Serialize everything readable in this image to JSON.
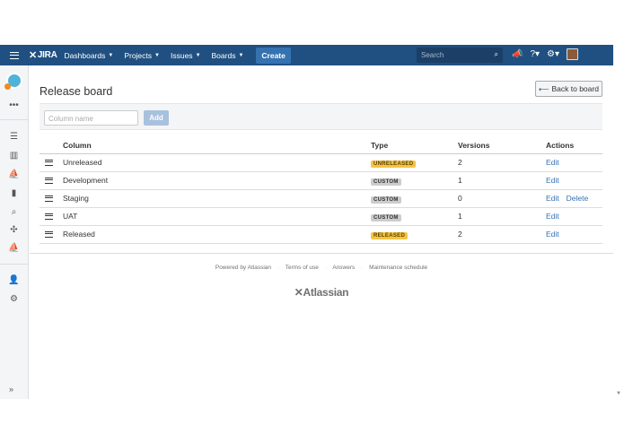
{
  "header": {
    "logo_text": "JIRA",
    "nav": [
      {
        "label": "Dashboards"
      },
      {
        "label": "Projects"
      },
      {
        "label": "Issues"
      },
      {
        "label": "Boards"
      }
    ],
    "create_label": "Create",
    "search_placeholder": "Search"
  },
  "page": {
    "title": "Release board",
    "back_label": "Back to board"
  },
  "add_column": {
    "placeholder": "Column name",
    "add_label": "Add"
  },
  "table": {
    "headers": {
      "column": "Column",
      "type": "Type",
      "versions": "Versions",
      "actions": "Actions"
    },
    "rows": [
      {
        "column": "Unreleased",
        "type": "UNRELEASED",
        "versions": "2",
        "edit": "Edit",
        "delete": ""
      },
      {
        "column": "Development",
        "type": "CUSTOM",
        "versions": "1",
        "edit": "Edit",
        "delete": ""
      },
      {
        "column": "Staging",
        "type": "CUSTOM",
        "versions": "0",
        "edit": "Edit",
        "delete": "Delete"
      },
      {
        "column": "UAT",
        "type": "CUSTOM",
        "versions": "1",
        "edit": "Edit",
        "delete": ""
      },
      {
        "column": "Released",
        "type": "RELEASED",
        "versions": "2",
        "edit": "Edit",
        "delete": ""
      }
    ]
  },
  "footer": {
    "powered": "Powered by Atlassian",
    "terms": "Terms of use",
    "answers": "Answers",
    "maintenance": "Maintenance schedule",
    "logo": "Atlassian"
  },
  "colors": {
    "header_bg": "#205081",
    "create_bg": "#3572b0",
    "link": "#3572b0",
    "lozenge_yellow": "#f6c342",
    "lozenge_grey": "#cccccc"
  },
  "icons": {
    "menu": "hamburger-icon",
    "notifications": "megaphone-icon",
    "help": "help-icon",
    "settings": "gear-icon",
    "search": "search-icon"
  }
}
